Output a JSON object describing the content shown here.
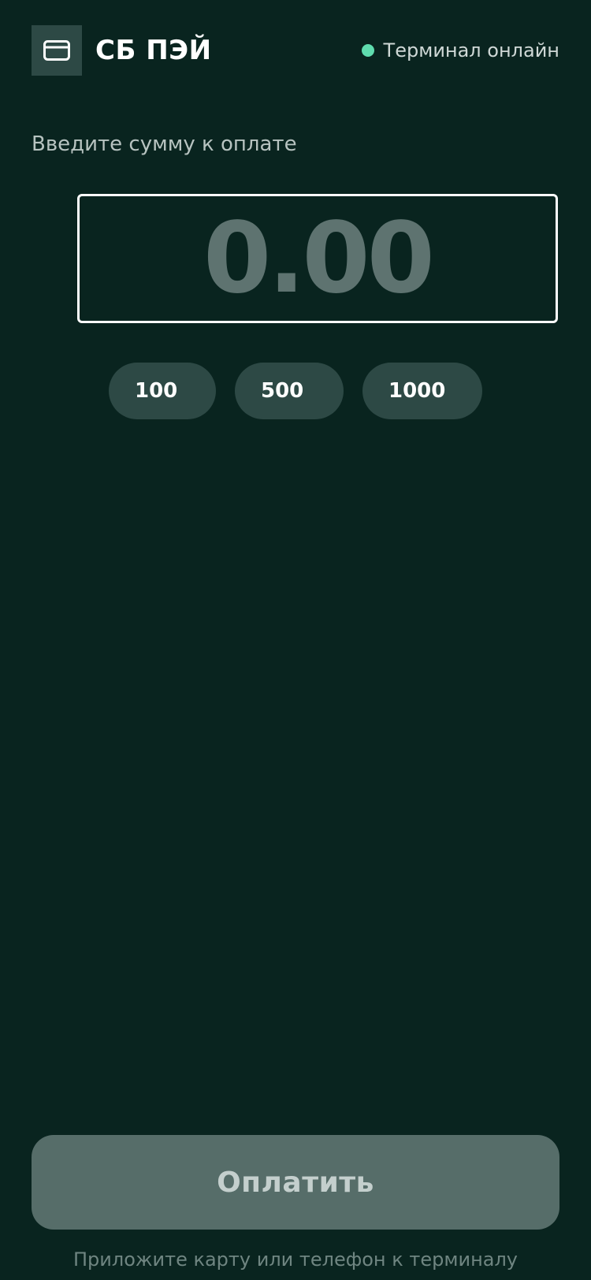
{
  "header": {
    "logo_icon": "card-icon",
    "brand": "СБ ПЭЙ",
    "status_text": "Терминал онлайн",
    "status_color": "#5fdcae"
  },
  "payment": {
    "prompt": "Введите сумму к оплате",
    "amount": "0.00",
    "quick_amounts": [
      "100",
      "500",
      "1000"
    ],
    "pay_label": "Оплатить",
    "hint": "Приложите карту или телефон к терминалу"
  },
  "colors": {
    "background": "#09241f",
    "surface": "#2d4945",
    "button": "#566d69",
    "amount_placeholder": "#5e7370"
  }
}
